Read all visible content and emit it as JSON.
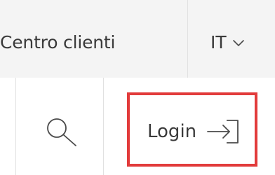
{
  "header": {
    "customer_center_label": "Centro clienti",
    "language": {
      "selected": "IT"
    }
  },
  "actions": {
    "login_label": "Login"
  },
  "icons": {
    "search": "search-icon",
    "language_dropdown": "chevron-down-icon",
    "login": "login-arrow-icon"
  },
  "colors": {
    "highlight_border": "#e23b3b",
    "topbar_background": "#f4f4f4",
    "text": "#3a3a3a"
  }
}
